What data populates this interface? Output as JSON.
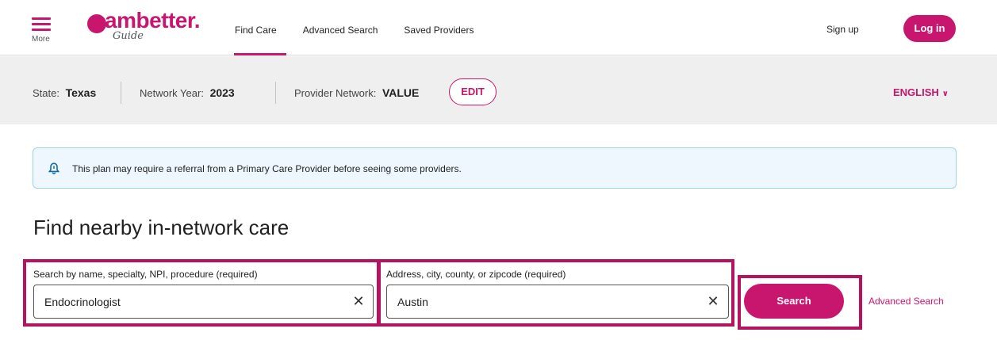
{
  "header": {
    "menu_label": "More",
    "logo_text": "ambetter.",
    "logo_subtext": "Guide",
    "nav": [
      {
        "label": "Find Care",
        "active": true
      },
      {
        "label": "Advanced Search",
        "active": false
      },
      {
        "label": "Saved Providers",
        "active": false
      }
    ],
    "signup_label": "Sign up",
    "login_label": "Log in"
  },
  "plan_bar": {
    "state_label": "State:",
    "state_value": "Texas",
    "year_label": "Network Year:",
    "year_value": "2023",
    "network_label": "Provider Network:",
    "network_value": "VALUE",
    "edit_label": "EDIT",
    "language_label": "ENGLISH"
  },
  "alert": {
    "text": "This plan may require a referral from a Primary Care Provider before seeing some providers.",
    "icon": "bell-icon"
  },
  "main": {
    "title": "Find nearby in-network care",
    "search_field": {
      "label": "Search by name, specialty, NPI, procedure (required)",
      "value": "Endocrinologist"
    },
    "location_field": {
      "label": "Address, city, county, or zipcode (required)",
      "value": "Austin"
    },
    "clear_glyph": "✕",
    "search_button_label": "Search",
    "advanced_search_link": "Advanced Search"
  },
  "colors": {
    "brand": "#c8166e",
    "highlight_border": "#b5125f",
    "plan_bar_bg": "#efefef",
    "alert_bg": "#eef7fd",
    "alert_border": "#9fd0ef"
  }
}
